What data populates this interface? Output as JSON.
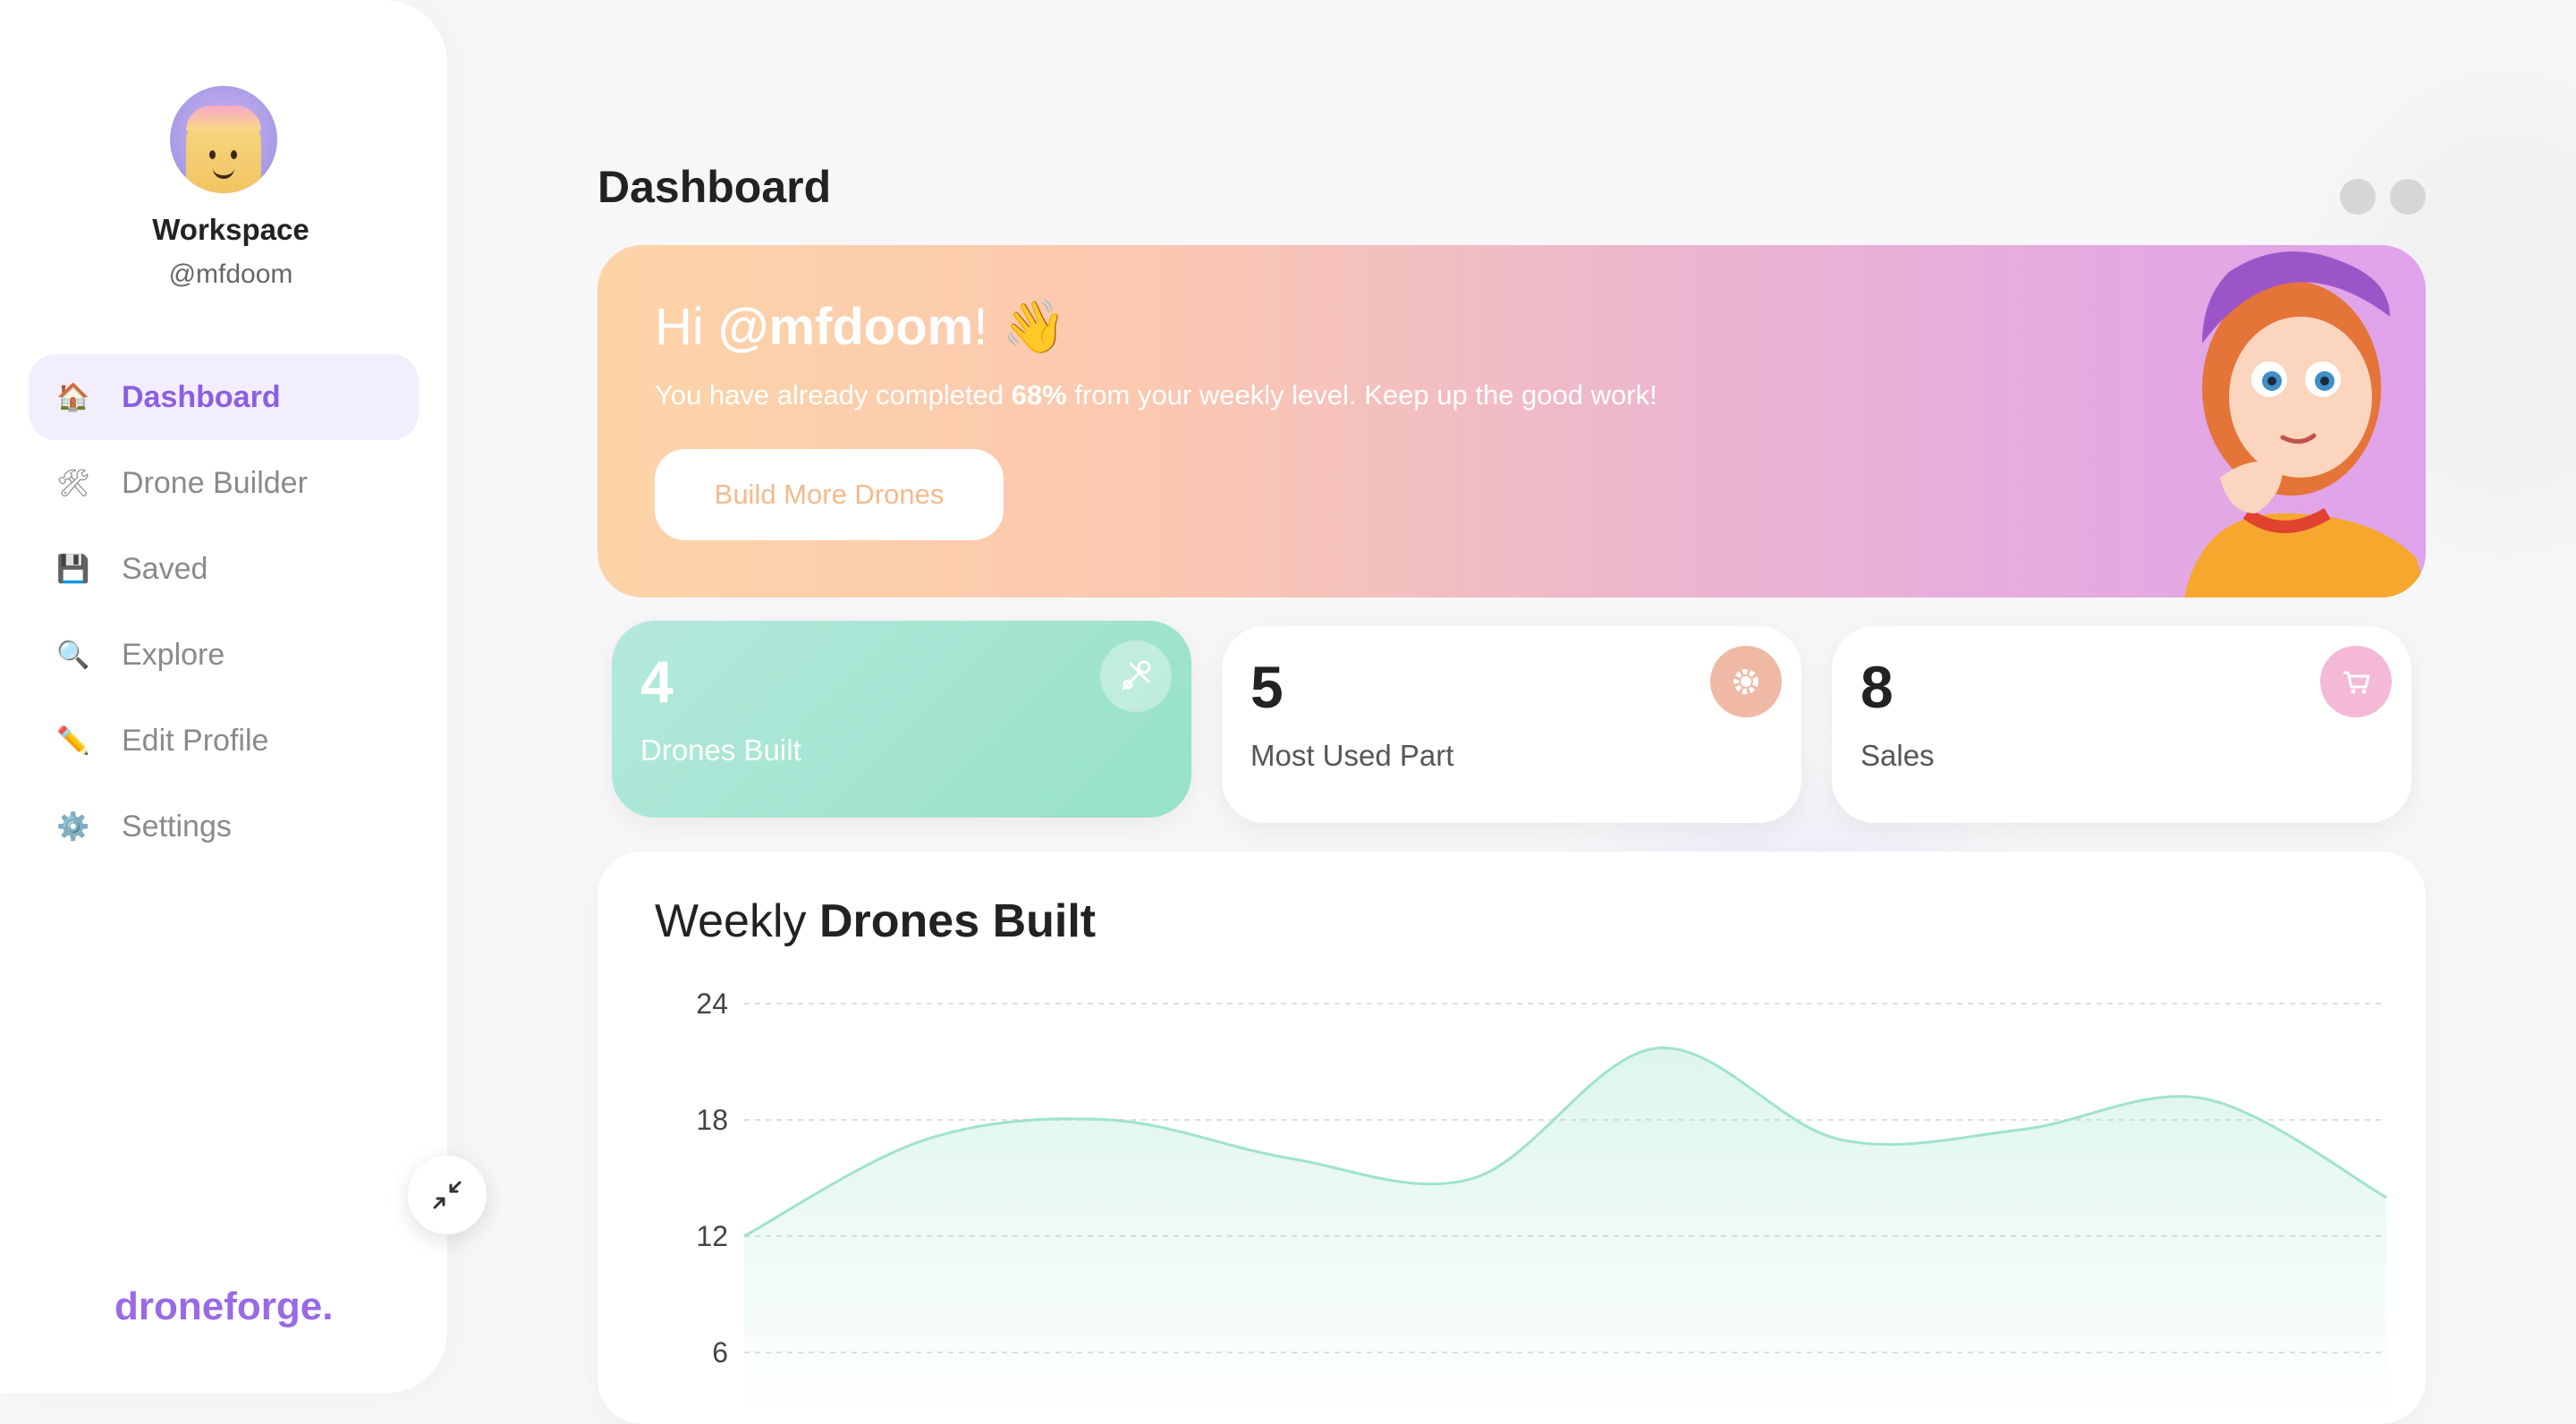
{
  "sidebar": {
    "workspace_name": "Workspace",
    "handle": "@mfdoom",
    "items": [
      {
        "label": "Dashboard",
        "icon": "🏠",
        "active": true
      },
      {
        "label": "Drone Builder",
        "icon": "🛠"
      },
      {
        "label": "Saved",
        "icon": "💾"
      },
      {
        "label": "Explore",
        "icon": "🔍"
      },
      {
        "label": "Edit Profile",
        "icon": "✏️"
      },
      {
        "label": "Settings",
        "icon": "⚙️"
      }
    ],
    "brand": "droneforge."
  },
  "header": {
    "title": "Dashboard"
  },
  "hero": {
    "greeting_prefix": "Hi ",
    "username": "@mfdoom",
    "greeting_suffix": "! 👋",
    "sub_prefix": "You have already completed ",
    "percent": "68%",
    "sub_suffix": " from your weekly level. Keep up the good work!",
    "button": "Build More Drones"
  },
  "stats": [
    {
      "value": "4",
      "label": "Drones Built",
      "icon": "tools-icon",
      "color": "#96e1c8"
    },
    {
      "value": "5",
      "label": "Most Used Part",
      "icon": "gear-icon",
      "color": "#f0b9a6"
    },
    {
      "value": "8",
      "label": "Sales",
      "icon": "cart-icon",
      "color": "#f3b9d6"
    }
  ],
  "chart_title": {
    "light": "Weekly ",
    "bold": "Drones Built"
  },
  "chart_data": {
    "type": "area",
    "title": "Weekly Drones Built",
    "yticks": [
      24,
      18,
      12,
      6
    ],
    "ylim": [
      0,
      24
    ],
    "values": [
      12,
      17,
      18,
      16,
      15,
      21.7,
      17,
      17.5,
      19.1,
      14
    ],
    "color": "#9fe2cf",
    "grid": true
  }
}
